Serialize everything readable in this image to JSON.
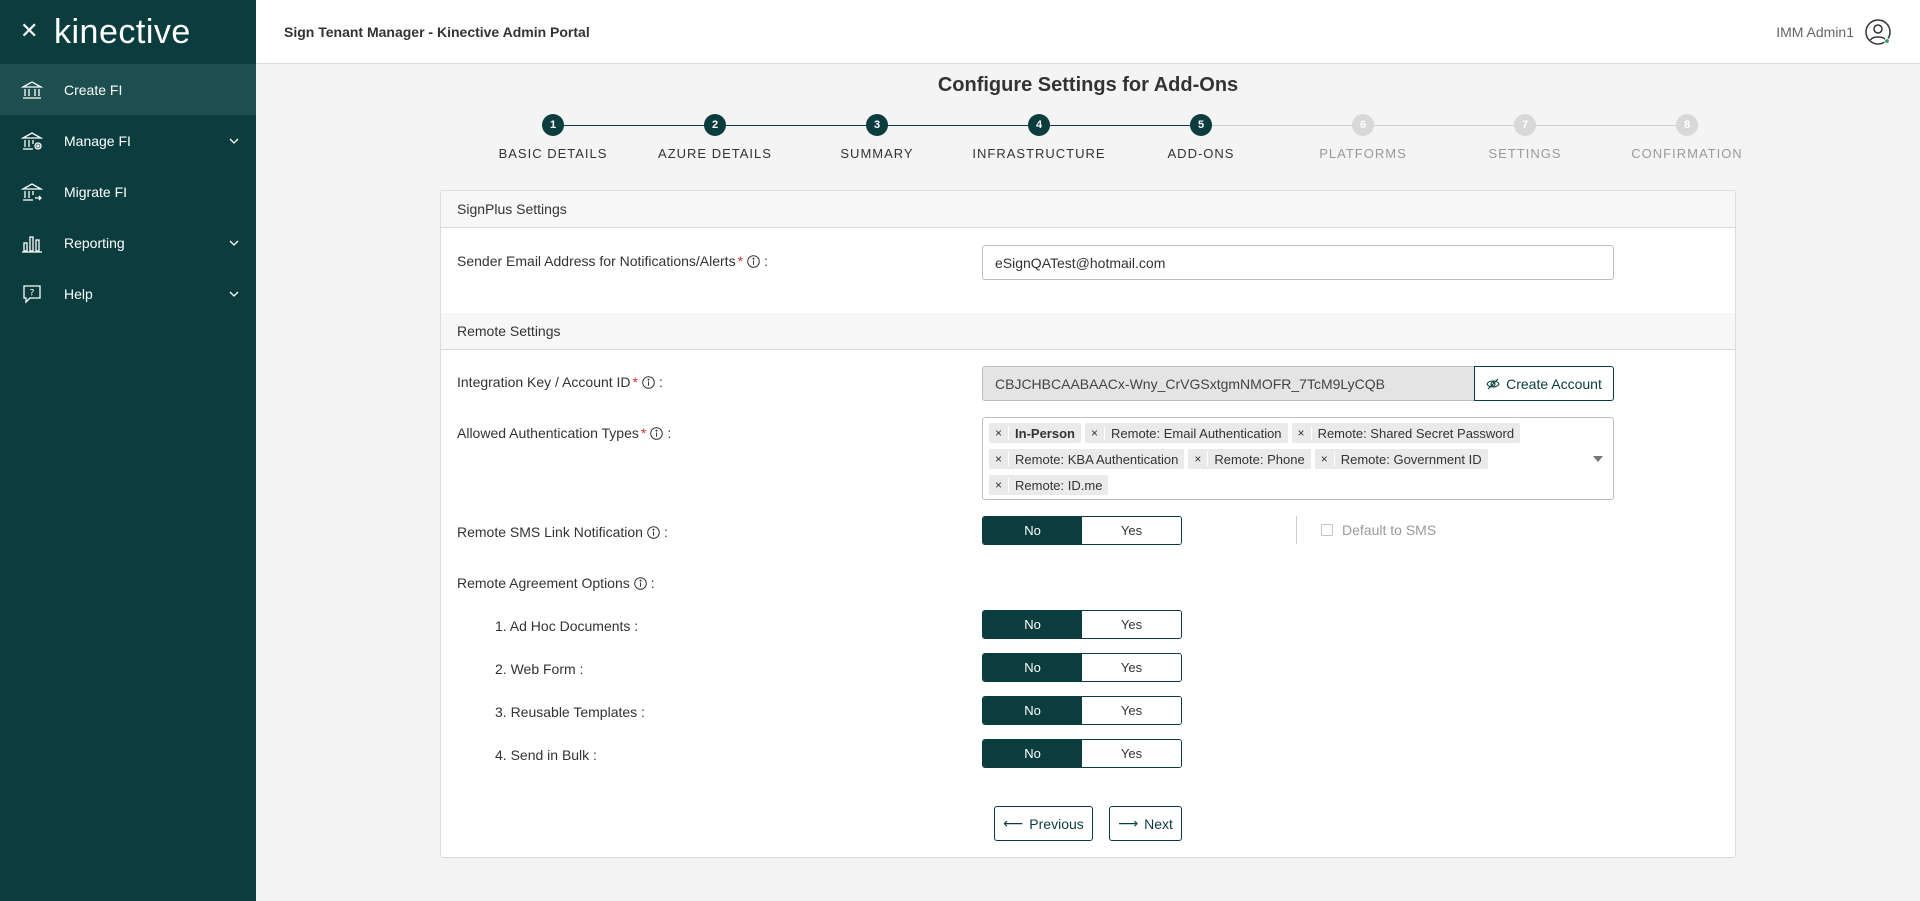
{
  "sidebar": {
    "close_icon": "close-icon",
    "logo_text": "kinective",
    "items": [
      {
        "label": "Create FI",
        "icon": "bank-icon",
        "active": true,
        "expandable": false
      },
      {
        "label": "Manage FI",
        "icon": "bank-settings-icon",
        "active": false,
        "expandable": true
      },
      {
        "label": "Migrate FI",
        "icon": "bank-migrate-icon",
        "active": false,
        "expandable": false
      },
      {
        "label": "Reporting",
        "icon": "bar-chart-icon",
        "active": false,
        "expandable": true
      },
      {
        "label": "Help",
        "icon": "help-icon",
        "active": false,
        "expandable": true
      }
    ]
  },
  "header": {
    "title": "Sign Tenant Manager - Kinective Admin Portal",
    "user_name": "IMM Admin1",
    "user_icon": "user-avatar-icon"
  },
  "page": {
    "title": "Configure Settings for Add-Ons"
  },
  "stepper": {
    "steps": [
      {
        "number": "1",
        "label": "BASIC DETAILS",
        "state": "complete"
      },
      {
        "number": "2",
        "label": "AZURE DETAILS",
        "state": "complete"
      },
      {
        "number": "3",
        "label": "SUMMARY",
        "state": "complete"
      },
      {
        "number": "4",
        "label": "INFRASTRUCTURE",
        "state": "complete"
      },
      {
        "number": "5",
        "label": "ADD-ONS",
        "state": "current"
      },
      {
        "number": "6",
        "label": "PLATFORMS",
        "state": "pending"
      },
      {
        "number": "7",
        "label": "SETTINGS",
        "state": "pending"
      },
      {
        "number": "8",
        "label": "CONFIRMATION",
        "state": "pending"
      }
    ]
  },
  "signplus": {
    "section_title": "SignPlus Settings",
    "sender_email_label": "Sender Email Address for Notifications/Alerts",
    "sender_email_value": "eSignQATest@hotmail.com"
  },
  "remote": {
    "section_title": "Remote Settings",
    "integration_key_label": "Integration Key / Account ID",
    "integration_key_value": "CBJCHBCAABAACx-Wny_CrVGSxtgmNMOFR_7TcM9LyCQB",
    "create_account_label": "Create Account",
    "auth_types_label": "Allowed Authentication Types",
    "auth_types": [
      "In-Person",
      "Remote: Email Authentication",
      "Remote: Shared Secret Password",
      "Remote: KBA Authentication",
      "Remote: Phone",
      "Remote: Government ID",
      "Remote: ID.me"
    ],
    "sms_label": "Remote SMS Link Notification",
    "sms_value": "No",
    "default_sms_label": "Default to SMS",
    "default_sms_checked": false,
    "agreement_label": "Remote Agreement Options",
    "agreement_options": [
      {
        "label": "1. Ad Hoc Documents :",
        "value": "No"
      },
      {
        "label": "2. Web Form :",
        "value": "No"
      },
      {
        "label": "3. Reusable Templates :",
        "value": "No"
      },
      {
        "label": "4. Send in Bulk :",
        "value": "No"
      }
    ],
    "toggle_no": "No",
    "toggle_yes": "Yes",
    "colon": ":",
    "required_mark": "*"
  },
  "footer": {
    "previous_label": "Previous",
    "next_label": "Next"
  },
  "colors": {
    "primary": "#0b3d3f",
    "required": "#d32f2f"
  }
}
